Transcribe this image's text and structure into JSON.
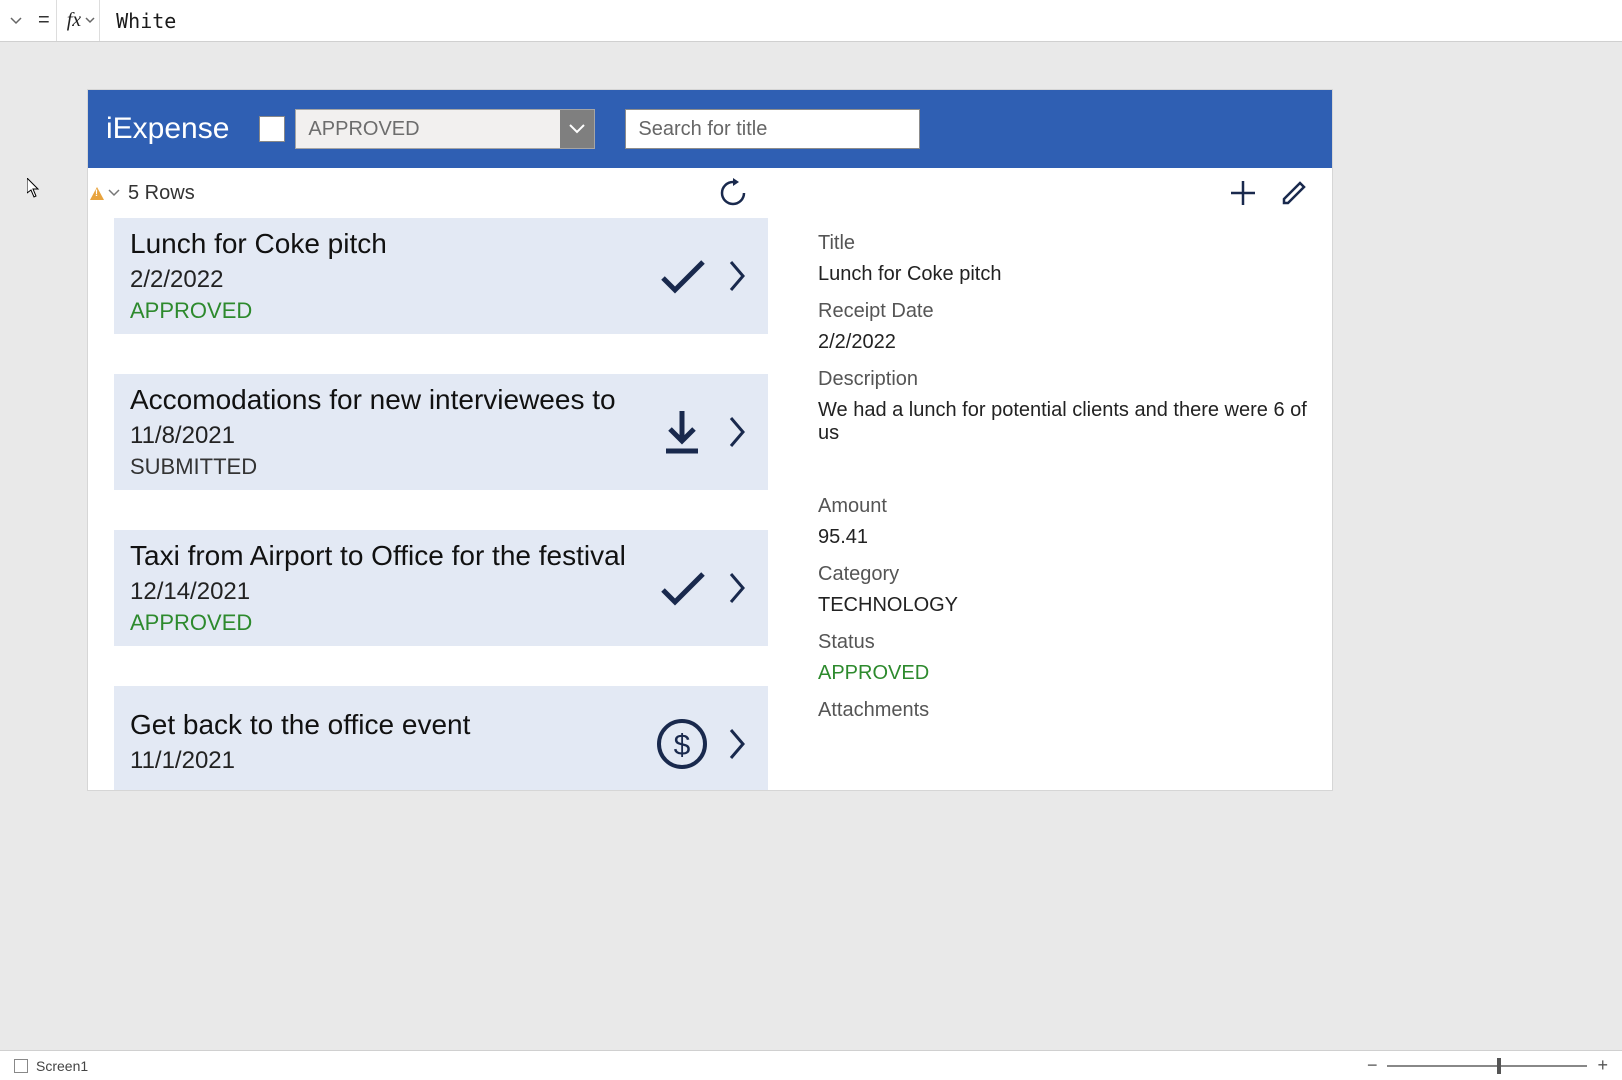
{
  "formula_bar": {
    "eq": "=",
    "fx": "fx",
    "value": "White"
  },
  "header": {
    "app_title": "iExpense",
    "filter_dropdown": "APPROVED",
    "search_placeholder": "Search for title"
  },
  "rows_bar": {
    "count_text": "5 Rows"
  },
  "list": [
    {
      "title": "Lunch for Coke pitch",
      "date": "2/2/2022",
      "status": "APPROVED",
      "status_class": "approved",
      "icon": "check"
    },
    {
      "title": "Accomodations for new interviewees to",
      "date": "11/8/2021",
      "status": "SUBMITTED",
      "status_class": "submitted",
      "icon": "download"
    },
    {
      "title": "Taxi from Airport to Office for the festival",
      "date": "12/14/2021",
      "status": "APPROVED",
      "status_class": "approved",
      "icon": "check"
    },
    {
      "title": "Get back to the office event",
      "date": "11/1/2021",
      "status": "",
      "status_class": "",
      "icon": "dollar"
    }
  ],
  "detail": {
    "labels": {
      "title": "Title",
      "receipt_date": "Receipt Date",
      "description": "Description",
      "amount": "Amount",
      "category": "Category",
      "status": "Status",
      "attachments": "Attachments"
    },
    "values": {
      "title": "Lunch for Coke pitch",
      "receipt_date": "2/2/2022",
      "description": "We had a lunch for potential clients and there were 6 of us",
      "amount": "95.41",
      "category": "TECHNOLOGY",
      "status": "APPROVED"
    }
  },
  "status_bar": {
    "screen": "Screen1"
  }
}
